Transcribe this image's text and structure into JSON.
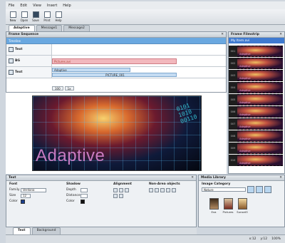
{
  "menu": [
    "File",
    "Edit",
    "View",
    "Insert",
    "Help"
  ],
  "toolbar": [
    {
      "label": "New",
      "icon": "new-icon"
    },
    {
      "label": "Open",
      "icon": "open-icon"
    },
    {
      "label": "Save",
      "icon": "save-icon"
    },
    {
      "label": "Print",
      "icon": "print-icon"
    },
    {
      "label": "Help",
      "icon": "help-icon"
    }
  ],
  "doc_tabs": [
    "Adaptive",
    "Message1",
    "Message2"
  ],
  "frame_sequence": {
    "title": "Frame Sequence",
    "timeline_label": "Timeline",
    "tracks": [
      {
        "name": "Text"
      },
      {
        "name": "BG",
        "clip": "Pictures.avi"
      },
      {
        "name": "Text",
        "clip": "Adaptive",
        "sub": "PICTURE_001"
      }
    ],
    "zoom": [
      "100",
      "1x"
    ]
  },
  "preview": {
    "word": "Adaptive",
    "digits": "0101\n1010\n00110"
  },
  "filmstrip": {
    "title": "Frame Filmstrip",
    "subtitle": "My Item.avi",
    "frames": [
      "001",
      "002",
      "003",
      "004",
      "005",
      "006",
      "007",
      "008",
      "009",
      "010"
    ]
  },
  "text_panel": {
    "title": "Text",
    "font": {
      "heading": "Font",
      "family_label": "Family",
      "family": "Verdana",
      "size_label": "Size",
      "size": "12",
      "color_label": "Color"
    },
    "shadow": {
      "heading": "Shadow",
      "depth": "Depth",
      "distance": "Distance",
      "color": "Color"
    },
    "alignment": {
      "heading": "Alignment"
    },
    "non_area": {
      "heading": "Non-Area objects"
    }
  },
  "bottom_tabs": [
    "Text",
    "Background"
  ],
  "library": {
    "title": "Media Library",
    "category_label": "Image Category",
    "category": "Nature",
    "items": [
      "Eva",
      "Pictures",
      "Sunset3"
    ]
  },
  "status": {
    "x": "x:12",
    "y": "y:12",
    "zoom": "100%"
  },
  "colors": {
    "accent": "#3f7ad0",
    "timeline": "#6aa8e0",
    "clip_pink": "#f2b8bd"
  }
}
